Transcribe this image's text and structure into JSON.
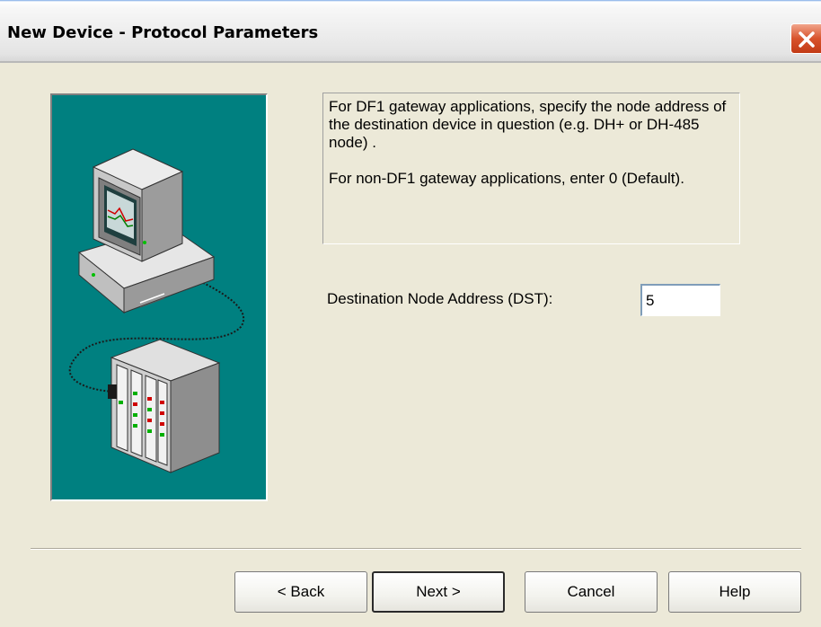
{
  "window": {
    "title": "New Device - Protocol Parameters"
  },
  "info": {
    "paragraph1": "For DF1 gateway applications, specify the node address of the destination device in question (e.g. DH+ or DH-485 node) .",
    "paragraph2": "For non-DF1 gateway applications, enter 0 (Default)."
  },
  "form": {
    "dst_label": "Destination Node Address (DST):",
    "dst_value": "5"
  },
  "buttons": {
    "back": "< Back",
    "next": "Next >",
    "cancel": "Cancel",
    "help": "Help"
  },
  "illustration": {
    "icons": [
      "computer-monitor-icon",
      "plc-rack-icon",
      "serial-cable-icon"
    ],
    "background_color": "#008080"
  },
  "colors": {
    "dialog_background": "#ece9d8",
    "close_button": "#d8532c"
  }
}
